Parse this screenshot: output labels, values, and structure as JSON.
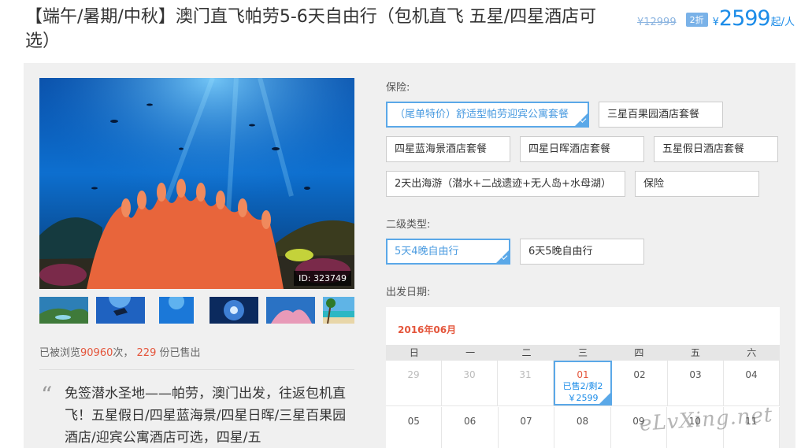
{
  "header": {
    "title": "【端午/暑期/中秋】澳门直飞帕劳5-6天自由行（包机直飞 五星/四星酒店可选）",
    "old_price": "¥12999",
    "discount": "2折",
    "currency": "¥",
    "price": "2599",
    "unit": "起/人"
  },
  "gallery": {
    "image_id": "ID: 323749",
    "thumbs": [
      "island-aerial",
      "diver",
      "underwater-blue",
      "jellyfish",
      "coral",
      "beach-palm"
    ]
  },
  "stats": {
    "prefix": "已被浏览",
    "views": "90960",
    "mid": "次，",
    "sold": "229",
    "suffix": " 份已售出"
  },
  "description": "免签潜水圣地——帕劳，澳门出发，往返包机直飞！五星假日/四星蓝海景/四星日晖/三星百果园酒店/迎宾公寓酒店可选，四星/五",
  "options": {
    "insurance_label": "保险:",
    "insurance": [
      "（尾单特价）舒适型帕劳迎宾公寓套餐",
      "三星百果园酒店套餐",
      "四星蓝海景酒店套餐",
      "四星日晖酒店套餐",
      "五星假日酒店套餐",
      "2天出海游（潜水+二战遗迹+无人岛+水母湖）",
      "保险"
    ],
    "sub_type_label": "二级类型:",
    "sub_types": [
      "5天4晚自由行",
      "6天5晚自由行"
    ],
    "date_label": "出发日期:"
  },
  "calendar": {
    "month": "2016年06月",
    "weekdays": [
      "日",
      "一",
      "二",
      "三",
      "四",
      "五",
      "六"
    ],
    "row1": [
      "29",
      "30",
      "31",
      "01",
      "02",
      "03",
      "04"
    ],
    "row2": [
      "05",
      "06",
      "07",
      "08",
      "09",
      "10",
      "11"
    ],
    "selected_info": "已售2/剩2",
    "selected_price": "￥2599"
  },
  "watermark": "eLvXing.net",
  "colors": {
    "accent": "#1c8ce8",
    "highlight": "#e4553b",
    "selected_border": "#5aa8e8"
  }
}
